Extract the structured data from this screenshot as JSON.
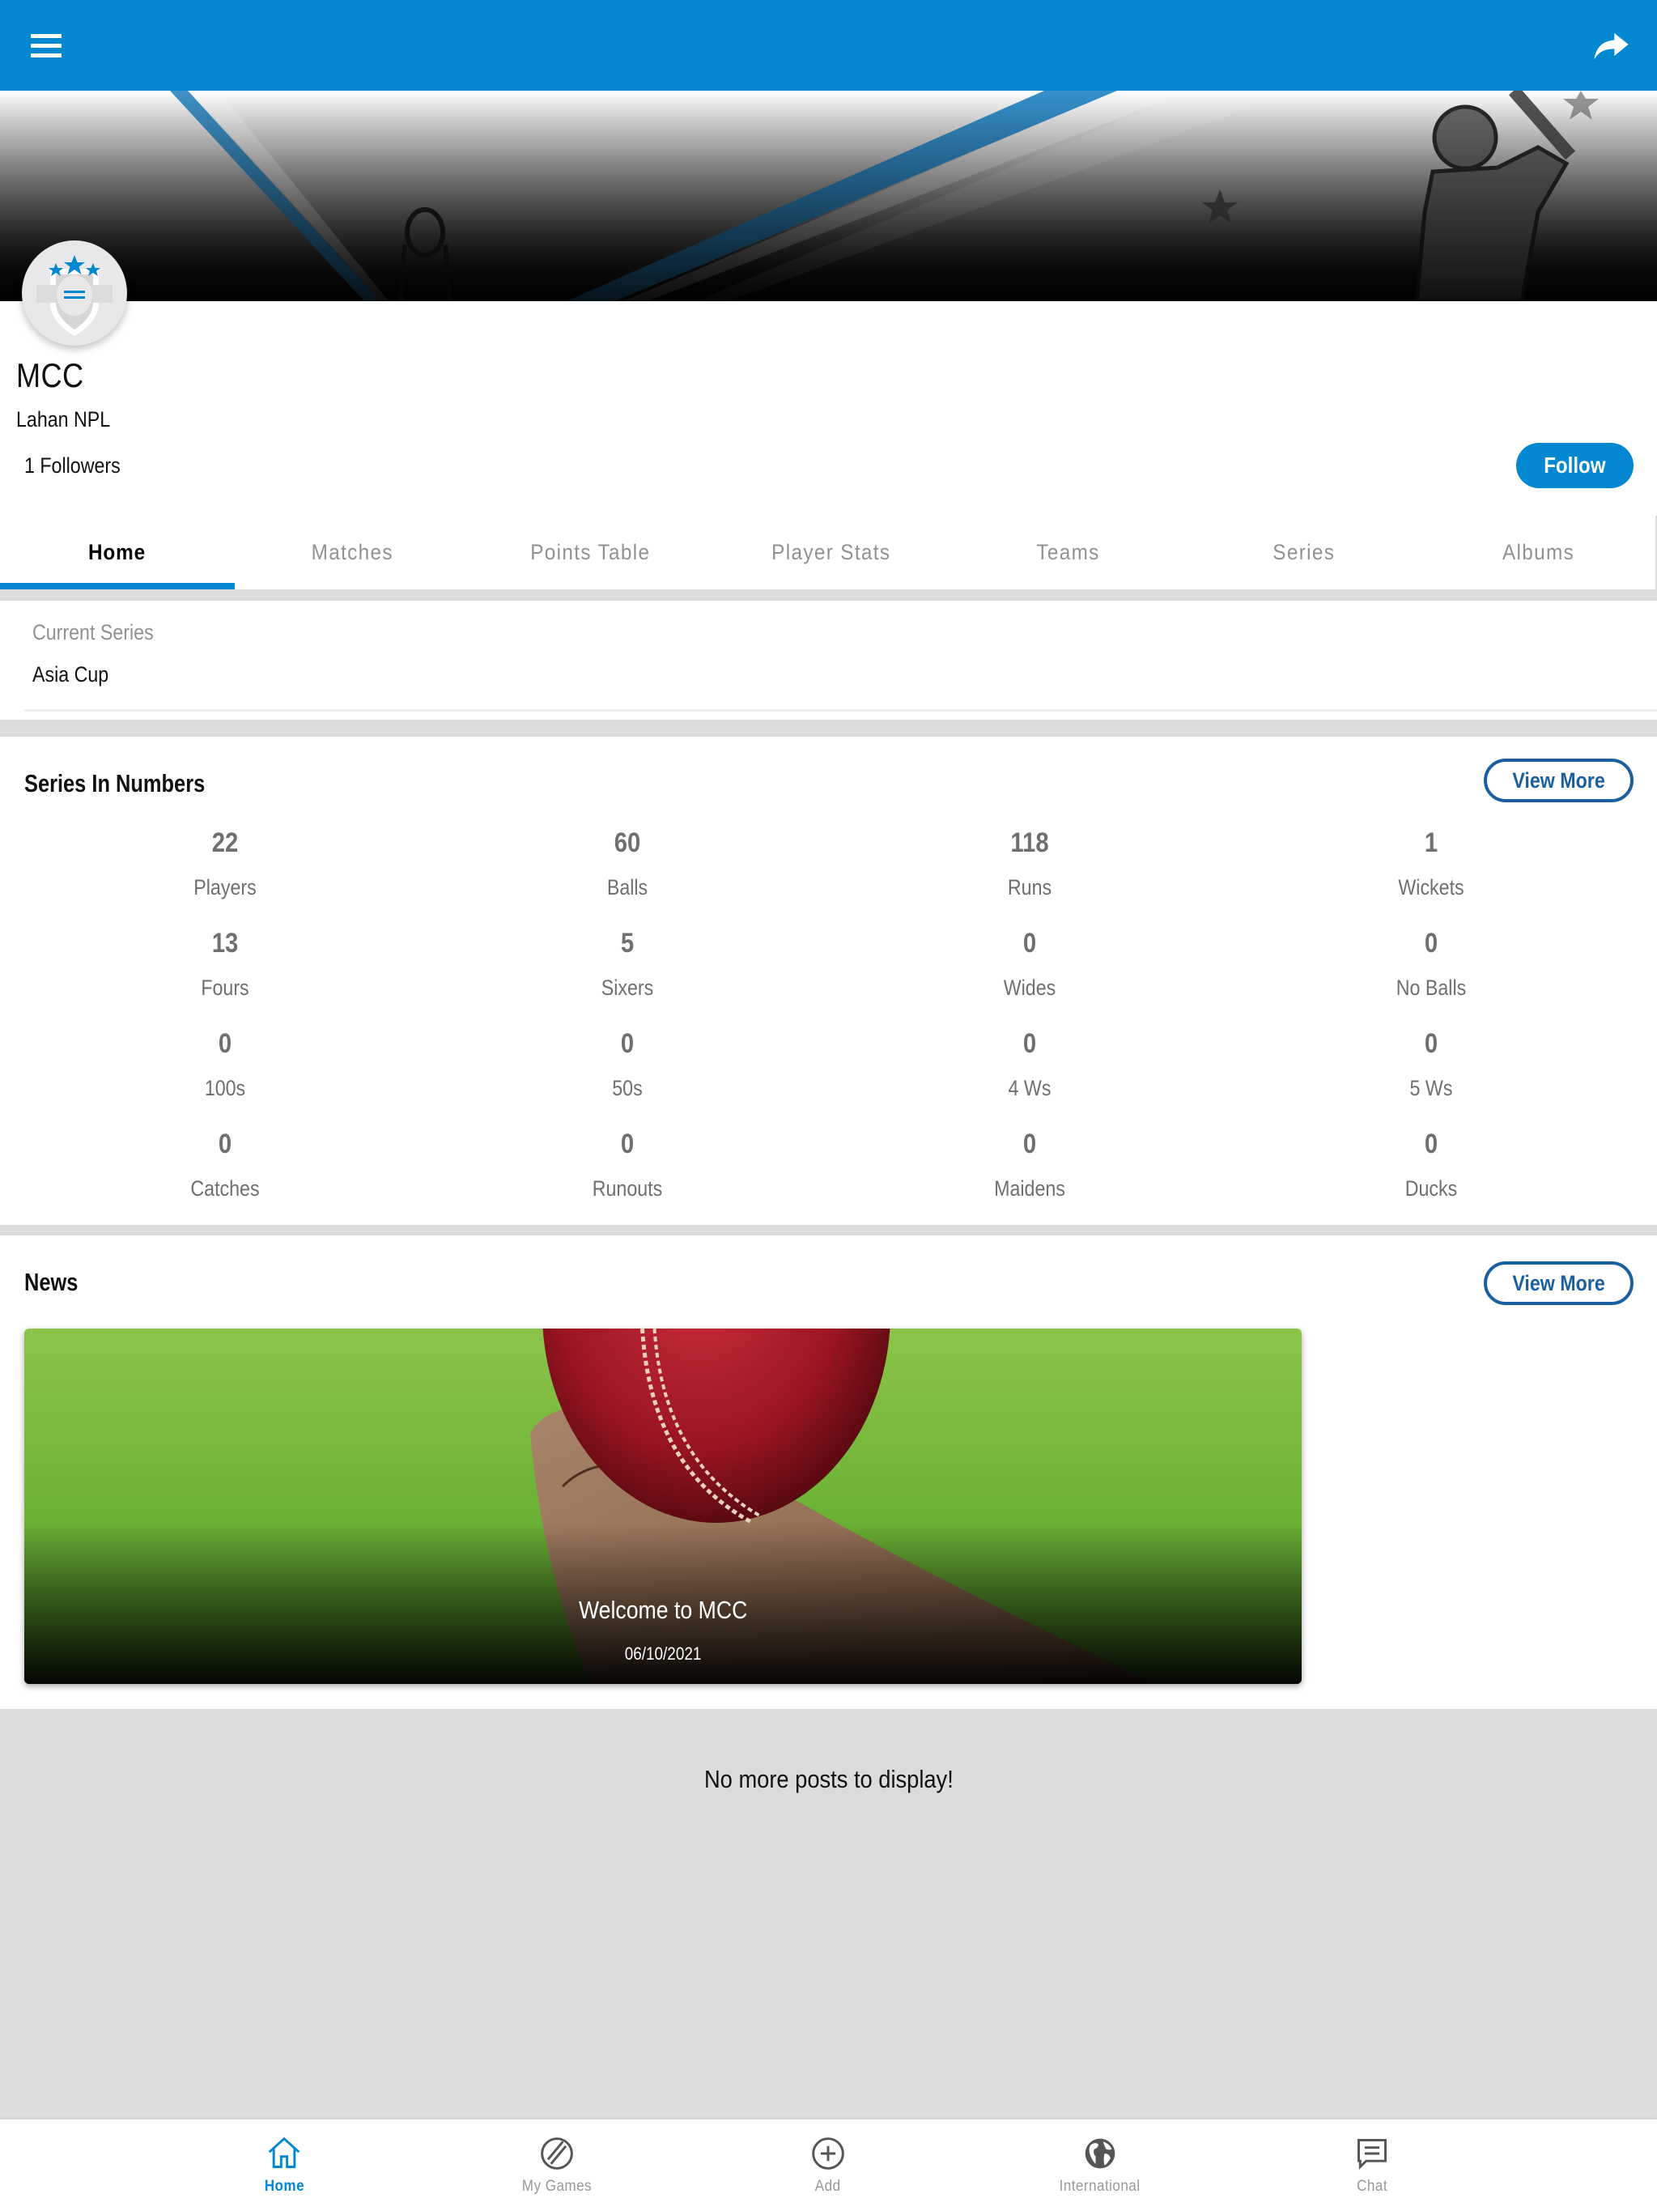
{
  "appbar": {
    "menu_icon": "hamburger-menu-icon",
    "share_icon": "share-arrow-icon",
    "color": "#0288d1"
  },
  "profile": {
    "team_name": "MCC",
    "location": "Lahan NPL",
    "followers": "1 Followers",
    "follow_label": "Follow"
  },
  "tabs": [
    {
      "label": "Home",
      "active": true
    },
    {
      "label": "Matches",
      "active": false
    },
    {
      "label": "Points Table",
      "active": false
    },
    {
      "label": "Player Stats",
      "active": false
    },
    {
      "label": "Teams",
      "active": false
    },
    {
      "label": "Series",
      "active": false
    },
    {
      "label": "Albums",
      "active": false
    }
  ],
  "current_series": {
    "label": "Current Series",
    "value": "Asia Cup"
  },
  "series_numbers": {
    "title": "Series In Numbers",
    "view_more": "View More",
    "stats": [
      {
        "value": "22",
        "label": "Players"
      },
      {
        "value": "60",
        "label": "Balls"
      },
      {
        "value": "118",
        "label": "Runs"
      },
      {
        "value": "1",
        "label": "Wickets"
      },
      {
        "value": "13",
        "label": "Fours"
      },
      {
        "value": "5",
        "label": "Sixers"
      },
      {
        "value": "0",
        "label": "Wides"
      },
      {
        "value": "0",
        "label": "No Balls"
      },
      {
        "value": "0",
        "label": "100s"
      },
      {
        "value": "0",
        "label": "50s"
      },
      {
        "value": "0",
        "label": "4 Ws"
      },
      {
        "value": "0",
        "label": "5 Ws"
      },
      {
        "value": "0",
        "label": "Catches"
      },
      {
        "value": "0",
        "label": "Runouts"
      },
      {
        "value": "0",
        "label": "Maidens"
      },
      {
        "value": "0",
        "label": "Ducks"
      }
    ]
  },
  "news": {
    "title": "News",
    "view_more": "View More",
    "items": [
      {
        "title": "Welcome to MCC",
        "date": "06/10/2021",
        "image": "cricket-ball-on-bat"
      }
    ],
    "end_message": "No more posts to display!"
  },
  "bottom_nav": [
    {
      "label": "Home",
      "icon": "home-icon",
      "active": true
    },
    {
      "label": "My Games",
      "icon": "cricket-ball-icon",
      "active": false
    },
    {
      "label": "Add",
      "icon": "add-circle-icon",
      "active": false
    },
    {
      "label": "International",
      "icon": "globe-icon",
      "active": false
    },
    {
      "label": "Chat",
      "icon": "chat-icon",
      "active": false
    }
  ]
}
